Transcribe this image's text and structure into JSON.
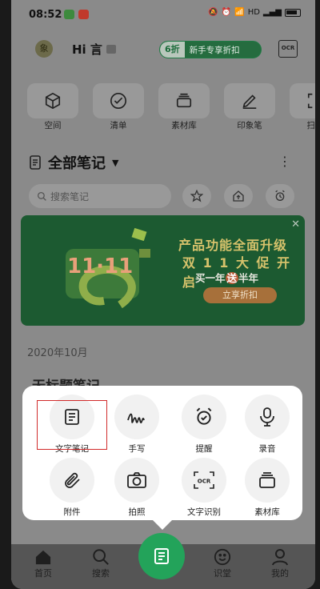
{
  "status_bar": {
    "time": "08:52",
    "network": "HD"
  },
  "header": {
    "greeting": "Hi 言",
    "promo_discount": "6折",
    "promo_text": "新手专享折扣",
    "ocr_label": "OCR"
  },
  "shortcuts": [
    {
      "label": "空间",
      "icon": "cube-icon"
    },
    {
      "label": "清单",
      "icon": "check-circle-icon"
    },
    {
      "label": "素材库",
      "icon": "tray-icon"
    },
    {
      "label": "印象笔",
      "icon": "pen-icon"
    },
    {
      "label": "扫描",
      "icon": "scan-icon"
    }
  ],
  "notes_section": {
    "title": "全部笔记",
    "search_placeholder": "搜索笔记"
  },
  "banner": {
    "badge": "11·11",
    "line1": "产品功能全面升级",
    "line2": "双 1 1 大 促 开 启",
    "line3_pre": "买一年",
    "line3_hl": "送",
    "line3_post": "半年",
    "cta": "立享折扣"
  },
  "date_header": "2020年10月",
  "note_title": "无标题笔记",
  "popup": {
    "items": [
      {
        "label": "文字笔记",
        "icon": "text-note-icon"
      },
      {
        "label": "手写",
        "icon": "handwriting-icon"
      },
      {
        "label": "提醒",
        "icon": "alarm-icon"
      },
      {
        "label": "录音",
        "icon": "microphone-icon"
      },
      {
        "label": "附件",
        "icon": "paperclip-icon"
      },
      {
        "label": "拍照",
        "icon": "camera-icon"
      },
      {
        "label": "文字识别",
        "icon": "ocr-icon"
      },
      {
        "label": "素材库",
        "icon": "tray-icon"
      }
    ]
  },
  "tabbar": {
    "items": [
      {
        "label": "首页",
        "icon": "home-icon"
      },
      {
        "label": "搜索",
        "icon": "search-icon"
      },
      {
        "label": "识堂",
        "icon": "smile-icon"
      },
      {
        "label": "我的",
        "icon": "person-icon"
      }
    ]
  },
  "colors": {
    "accent": "#23a35a",
    "highlight": "#d12a2a",
    "dim_overlay": "#8a8a8a"
  }
}
